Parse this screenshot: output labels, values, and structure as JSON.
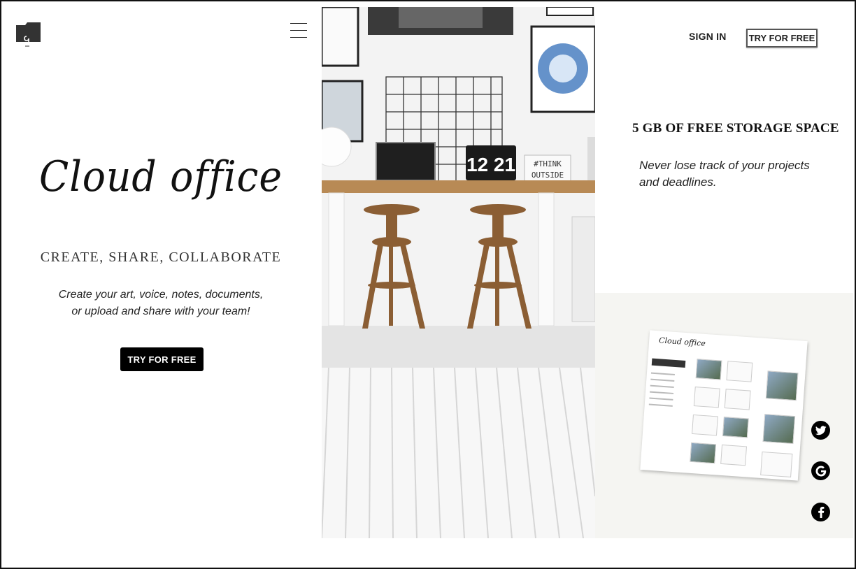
{
  "header": {
    "menu_icon": "hamburger-icon",
    "logo_icon": "folder-logo-icon",
    "sign_in_label": "SIGN IN",
    "try_free_label": "TRY FOR FREE"
  },
  "hero": {
    "brand": "Cloud office",
    "tagline": "CREATE, SHARE, COLLABORATE",
    "description_line1": "Create your art, voice, notes, documents,",
    "description_line2": "or upload and share with your team!",
    "cta_label": "TRY FOR FREE"
  },
  "photo": {
    "clock_text": "12 21",
    "lightbox_line1": "#THINK",
    "lightbox_line2": "OUTSIDE"
  },
  "feature": {
    "title": "5 GB OF FREE STORAGE SPACE",
    "description_line1": "Never lose track of your projects",
    "description_line2": "and deadlines."
  },
  "app_preview": {
    "brand": "Cloud office"
  },
  "social": [
    {
      "name": "twitter-icon"
    },
    {
      "name": "google-icon"
    },
    {
      "name": "facebook-icon"
    }
  ],
  "colors": {
    "primary_button": "#000000",
    "panel_background": "#f5f5f2",
    "text": "#111111"
  }
}
